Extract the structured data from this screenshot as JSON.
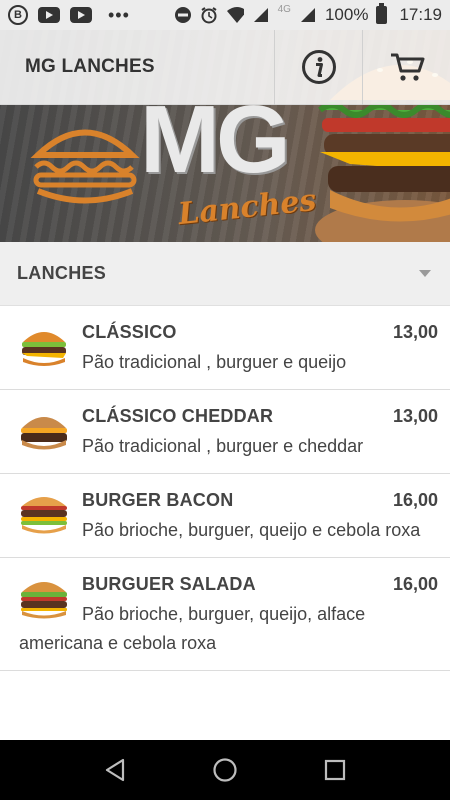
{
  "status_bar": {
    "badge": "B",
    "signal_label": "4G",
    "battery": "100%",
    "time": "17:19"
  },
  "app": {
    "title": "MG LANCHES",
    "info_icon": "info-circle-icon",
    "cart_icon": "cart-icon"
  },
  "banner": {
    "logo_text": "MG",
    "logo_script": "Lanches"
  },
  "category": {
    "label": "LANCHES",
    "icon": "chevron-down-icon"
  },
  "products": [
    {
      "name": "CLÁSSICO",
      "price": "13,00",
      "description": "Pão tradicional , burguer e queijo"
    },
    {
      "name": "CLÁSSICO CHEDDAR",
      "price": "13,00",
      "description": "Pão tradicional , burguer e cheddar"
    },
    {
      "name": "BURGER BACON",
      "price": "16,00",
      "description": "Pão brioche, burguer, queijo e cebola roxa"
    },
    {
      "name": "BURGUER SALADA",
      "price": "16,00",
      "description": "Pão brioche, burguer, queijo, alface americana e cebola roxa"
    }
  ],
  "nav": {
    "back": "back-triangle-icon",
    "home": "home-circle-icon",
    "recents": "recents-square-icon"
  },
  "colors": {
    "accent_orange": "#d9822b",
    "header_bg": "#efefef",
    "text": "#444444"
  }
}
